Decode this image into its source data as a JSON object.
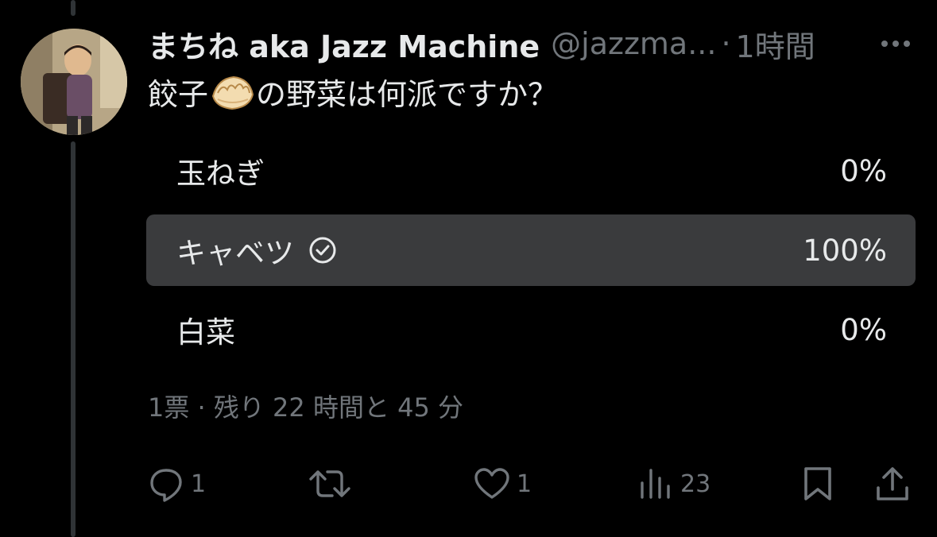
{
  "tweet": {
    "display_name": "まちね aka Jazz Machine",
    "handle": "@jazzma...",
    "separator": "·",
    "time": "1時間",
    "text_before": "餃子",
    "text_after": "の野菜は何派ですか？",
    "emoji_icon": "dumpling-icon"
  },
  "poll": {
    "options": [
      {
        "label": "玉ねぎ",
        "percent": "0%",
        "winner": false
      },
      {
        "label": "キャベツ",
        "percent": "100%",
        "winner": true
      },
      {
        "label": "白菜",
        "percent": "0%",
        "winner": false
      }
    ],
    "meta": "1票 · 残り 22 時間と 45 分"
  },
  "actions": {
    "reply_count": "1",
    "retweet_count": "",
    "like_count": "1",
    "views_count": "23"
  },
  "colors": {
    "background": "#000000",
    "text": "#e7e9ea",
    "muted": "#71767b",
    "winner_bar": "#3a3b3d"
  }
}
